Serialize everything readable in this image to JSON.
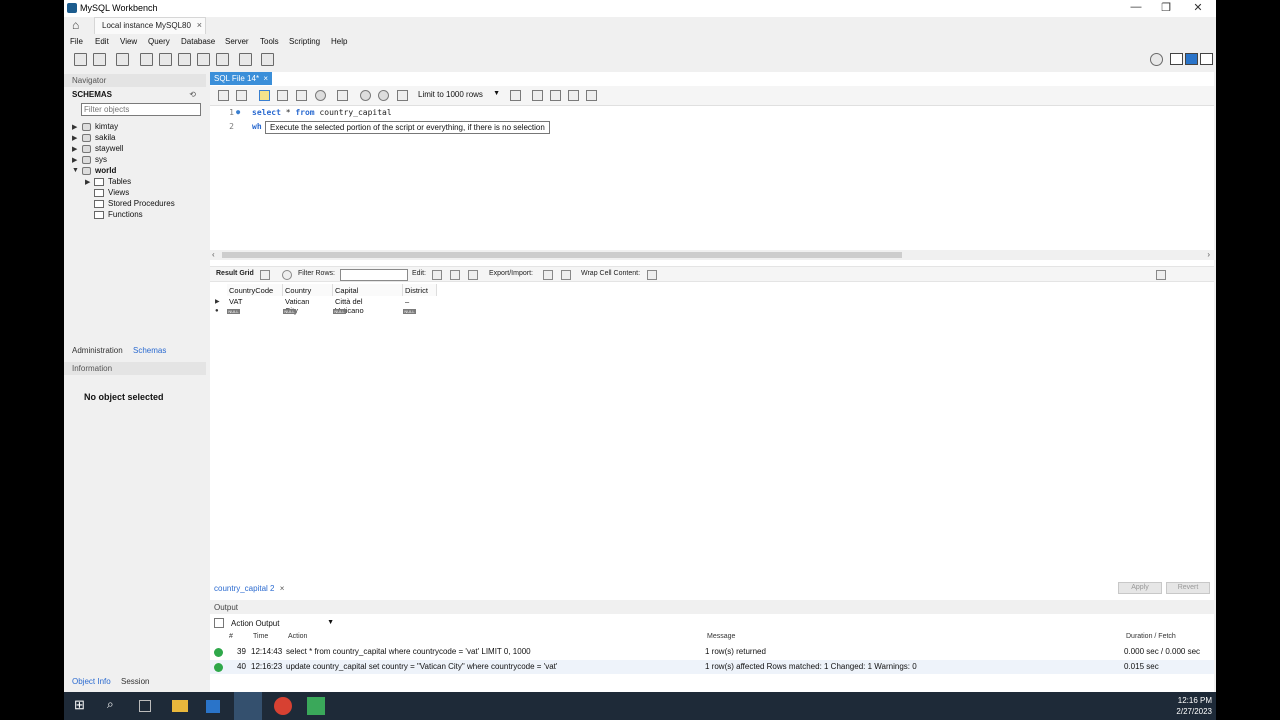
{
  "window": {
    "title": "MySQL Workbench",
    "minimize": "—",
    "maximize": "❐",
    "close": "✕"
  },
  "connection": {
    "tab_label": "Local instance MySQL80",
    "close": "×"
  },
  "menu": [
    "File",
    "Edit",
    "View",
    "Query",
    "Database",
    "Server",
    "Tools",
    "Scripting",
    "Help"
  ],
  "navigator": {
    "header": "Navigator",
    "schemas_label": "SCHEMAS",
    "filter_placeholder": "Filter objects",
    "schemas": [
      "kimtay",
      "sakila",
      "staywell",
      "sys",
      "world"
    ],
    "world_children": [
      "Tables",
      "Views",
      "Stored Procedures",
      "Functions"
    ],
    "tabs": [
      "Administration",
      "Schemas"
    ],
    "info_header": "Information",
    "no_object": "No object selected",
    "bottom_tabs": [
      "Object Info",
      "Session"
    ]
  },
  "editor": {
    "tab_label": "SQL File 14*",
    "limit_label": "Limit to 1000 rows",
    "lines": [
      {
        "num": "1",
        "kw1": "select",
        "mid": " * ",
        "kw2": "from",
        "rest": " country_capital"
      },
      {
        "num": "2",
        "kw1": "wh",
        "mid": "",
        "kw2": "",
        "rest": ""
      }
    ],
    "tooltip": "Execute the selected portion of the script or everything, if there is no selection"
  },
  "result_toolbar": {
    "result_grid": "Result Grid",
    "filter_rows": "Filter Rows:",
    "edit": "Edit:",
    "export_import": "Export/Import:",
    "wrap": "Wrap Cell Content:"
  },
  "grid": {
    "columns": [
      "CountryCode",
      "Country",
      "Capital",
      "District"
    ],
    "row": [
      "VAT",
      "Vatican City",
      "Città del Vaticano",
      "–"
    ],
    "null_label": "NULL"
  },
  "result_tab": {
    "label": "country_capital 2",
    "close": "×"
  },
  "buttons": {
    "apply": "Apply",
    "revert": "Revert"
  },
  "output": {
    "header": "Output",
    "selector": "Action Output",
    "columns": {
      "num": "#",
      "time": "Time",
      "action": "Action",
      "message": "Message",
      "duration": "Duration / Fetch"
    },
    "rows": [
      {
        "num": "39",
        "time": "12:14:43",
        "action": "select * from country_capital where countrycode = 'vat' LIMIT 0, 1000",
        "message": "1 row(s) returned",
        "duration": "0.000 sec / 0.000 sec"
      },
      {
        "num": "40",
        "time": "12:16:23",
        "action": "update country_capital set country = \"Vatican City\" where countrycode = 'vat'",
        "message": "1 row(s) affected Rows matched: 1  Changed: 1  Warnings: 0",
        "duration": "0.015 sec"
      }
    ]
  },
  "taskbar": {
    "time": "12:16 PM",
    "date": "2/27/2023"
  },
  "colors": {
    "accent": "#3b8fd9",
    "ok": "#2fa84a",
    "keyword": "#2a6ad0",
    "taskbar": "#1e2a38"
  }
}
